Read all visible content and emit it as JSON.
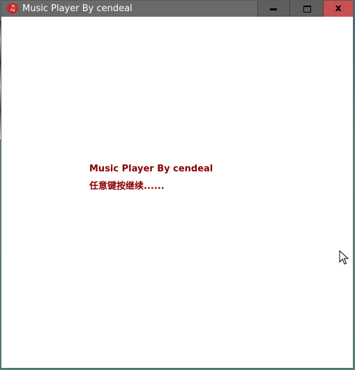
{
  "window": {
    "title": "Music Player By cendeal",
    "icon": "music-note-icon",
    "controls": {
      "minimize_icon": "minimize-icon",
      "maximize_icon": "maximize-icon",
      "close_glyph": "x",
      "close_color": "#c75050"
    }
  },
  "content": {
    "line1": "Music Player By cendeal",
    "line2": "任意键按继续......",
    "text_color": "#8b0000"
  },
  "cursor": {
    "icon": "mouse-pointer-icon"
  }
}
